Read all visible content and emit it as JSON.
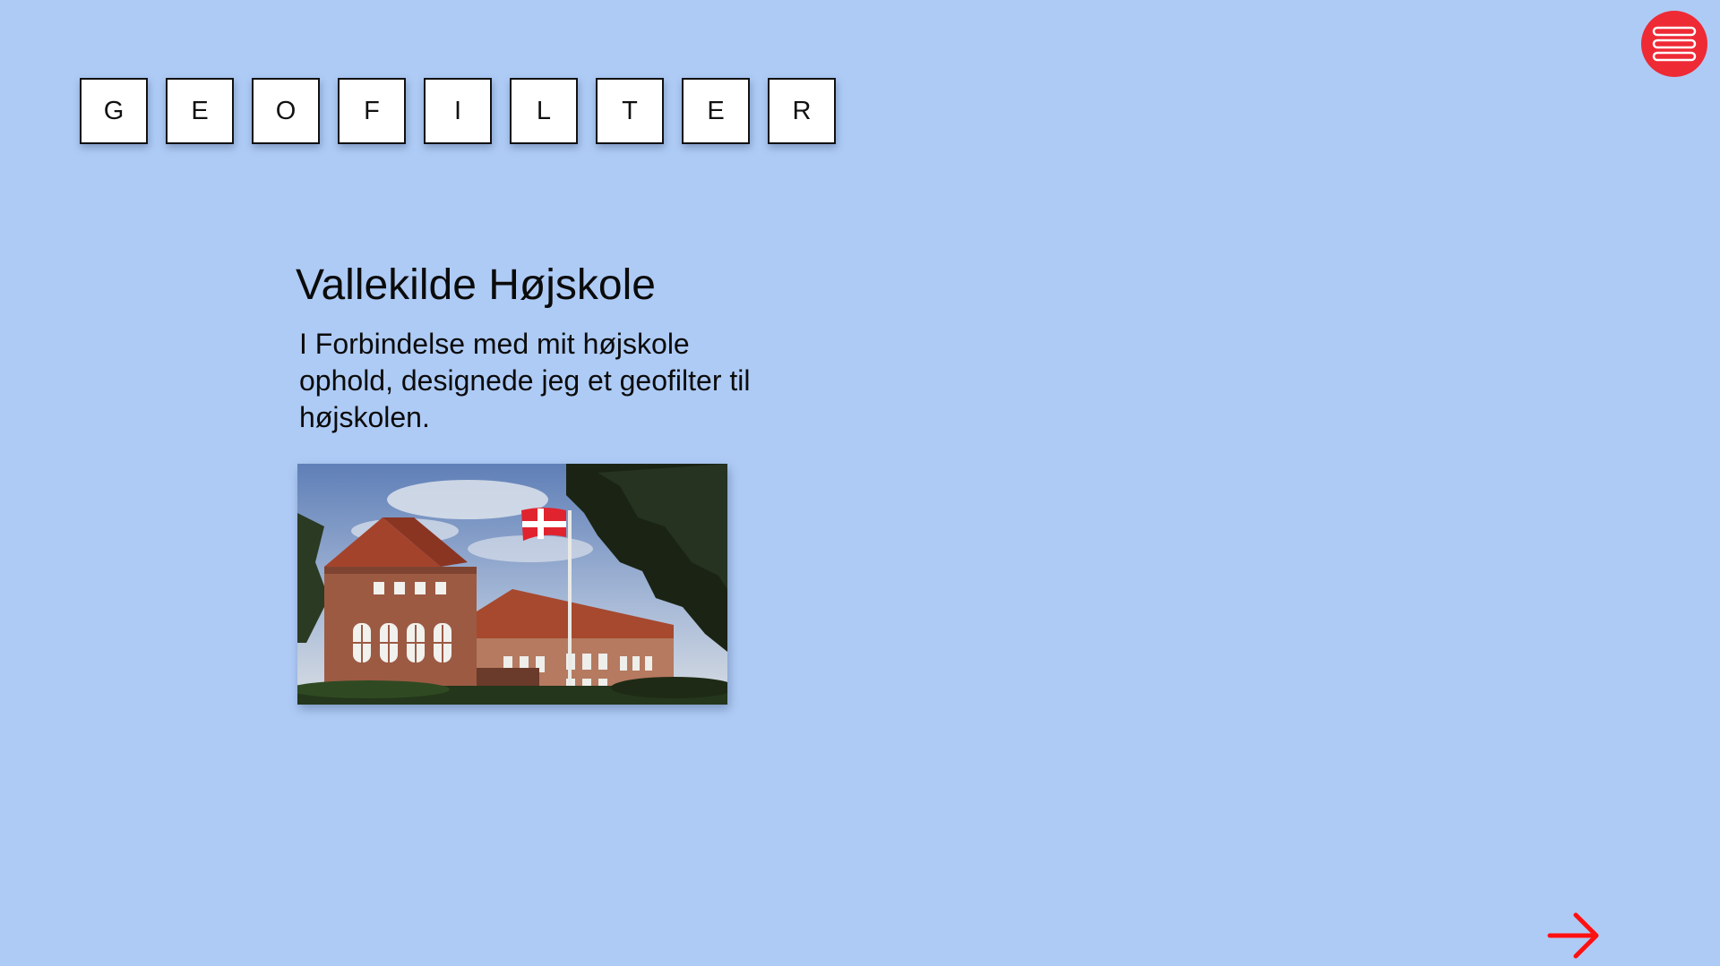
{
  "logo_tiles": [
    "G",
    "E",
    "O",
    "F",
    "I",
    "L",
    "T",
    "E",
    "R"
  ],
  "project": {
    "title": "Vallekilde Højskole",
    "description": "I Forbindelse med mit højskole ophold, designede jeg et geofilter til højskolen."
  },
  "icons": {
    "menu": "hamburger-menu-icon",
    "next": "arrow-right-icon"
  },
  "colors": {
    "background": "#aecbf5",
    "accent": "#ee2a35",
    "arrow": "#ff1010"
  }
}
